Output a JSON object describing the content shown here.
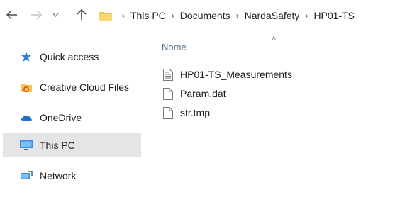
{
  "address_bar": {
    "breadcrumbs": [
      "This PC",
      "Documents",
      "NardaSafety",
      "HP01-TS"
    ],
    "separator": ">"
  },
  "sidebar": {
    "items": [
      {
        "label": "Quick access",
        "icon": "star-icon"
      },
      {
        "label": "Creative Cloud Files",
        "icon": "creative-cloud-folder-icon"
      },
      {
        "label": "OneDrive",
        "icon": "cloud-icon"
      },
      {
        "label": "This PC",
        "icon": "computer-icon",
        "selected": true
      },
      {
        "label": "Network",
        "icon": "network-icon"
      }
    ]
  },
  "file_list": {
    "column_header": "Nome",
    "files": [
      {
        "name": "HP01-TS_Measurements",
        "icon": "text-document-icon"
      },
      {
        "name": "Param.dat",
        "icon": "file-icon"
      },
      {
        "name": "str.tmp",
        "icon": "file-icon"
      }
    ]
  },
  "colors": {
    "selected_bg": "#e5e5e5",
    "header_text": "#4d6a8a",
    "folder_yellow": "#f2c94c"
  }
}
